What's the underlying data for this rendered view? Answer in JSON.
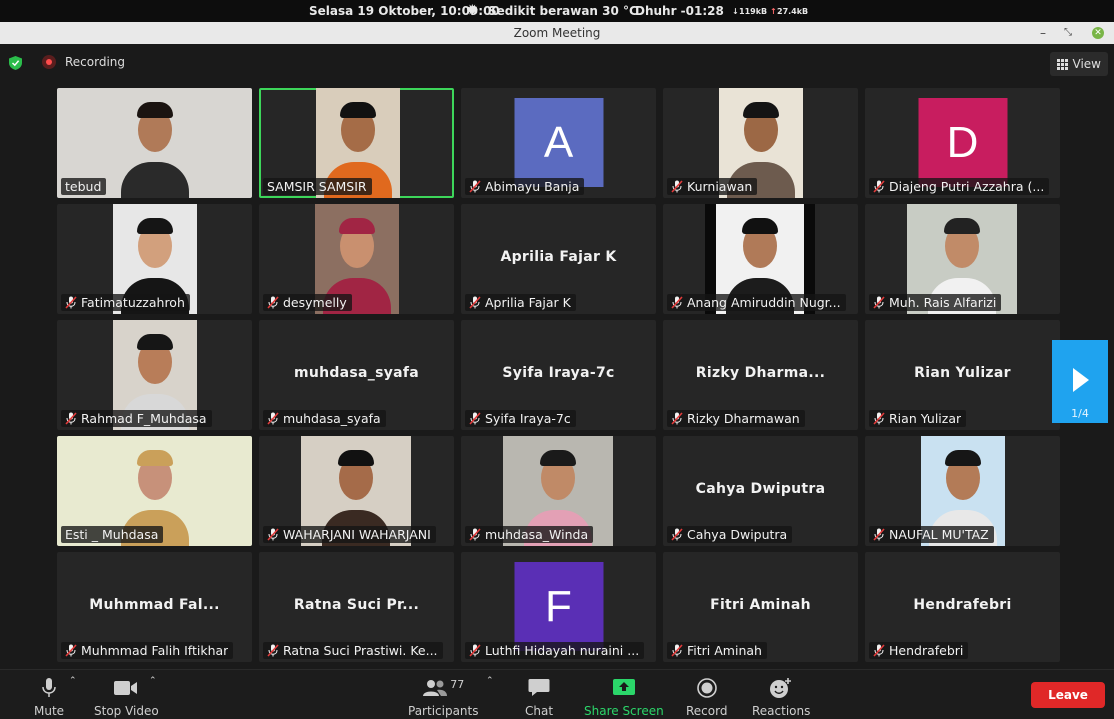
{
  "os_bar": {
    "datetime": "Selasa 19 Oktober, 10:09:00",
    "weather": "Sedikit berawan 30 °C",
    "prayer": "Dhuhr -01:28",
    "net_down": "119kB",
    "net_up": "27.4kB"
  },
  "window": {
    "title": "Zoom Meeting"
  },
  "meeting": {
    "recording_label": "Recording",
    "view_label": "View",
    "page_indicator": "1/4"
  },
  "tiles": [
    {
      "name": "tebud",
      "muted": false,
      "video": true
    },
    {
      "name": "SAMSIR SAMSIR",
      "muted": false,
      "video": true,
      "active": true
    },
    {
      "name": "Abimayu Banja",
      "muted": true,
      "avatar_letter": "A",
      "avatar_color": "#5b6bc0"
    },
    {
      "name": "Kurniawan",
      "muted": true,
      "video": true
    },
    {
      "name": "Diajeng Putri Azzahra (...",
      "muted": true,
      "avatar_letter": "D",
      "avatar_color": "#c81d5f"
    },
    {
      "name": "Fatimatuzzahroh",
      "muted": true,
      "video": true
    },
    {
      "name": "desymelly",
      "muted": true,
      "video": true
    },
    {
      "name": "Aprilia Fajar K",
      "muted": true,
      "display": "Aprilia Fajar K"
    },
    {
      "name": "Anang Amiruddin Nugr...",
      "muted": true,
      "video": true
    },
    {
      "name": "Muh. Rais Alfarizi",
      "muted": true,
      "video": true
    },
    {
      "name": "Rahmad F_Muhdasa",
      "muted": true,
      "video": true
    },
    {
      "name": "muhdasa_syafa",
      "muted": true,
      "display": "muhdasa_syafa"
    },
    {
      "name": "Syifa Iraya-7c",
      "muted": true,
      "display": "Syifa Iraya-7c"
    },
    {
      "name": "Rizky Dharmawan",
      "muted": true,
      "display": "Rizky Dharma..."
    },
    {
      "name": "Rian Yulizar",
      "muted": true,
      "display": "Rian Yulizar"
    },
    {
      "name": "Esti _ Muhdasa",
      "muted": false,
      "video": true
    },
    {
      "name": "WAHARJANI WAHARJANI",
      "muted": true,
      "video": true
    },
    {
      "name": "muhdasa_Winda",
      "muted": true,
      "video": true
    },
    {
      "name": "Cahya Dwiputra",
      "muted": true,
      "display": "Cahya Dwiputra"
    },
    {
      "name": "NAUFAL MU'TAZ",
      "muted": true,
      "video": true
    },
    {
      "name": "Muhmmad Falih Iftikhar",
      "muted": true,
      "display": "Muhmmad Fal..."
    },
    {
      "name": "Ratna Suci Prastiwi. Ke...",
      "muted": true,
      "display": "Ratna Suci Pr..."
    },
    {
      "name": "Luthfi Hidayah nuraini ...",
      "muted": true,
      "avatar_letter": "F",
      "avatar_color": "#5a2fb5"
    },
    {
      "name": "Fitri Aminah",
      "muted": true,
      "display": "Fitri Aminah"
    },
    {
      "name": "Hendrafebri",
      "muted": true,
      "display": "Hendrafebri"
    }
  ],
  "toolbar": {
    "mute": "Mute",
    "stop_video": "Stop Video",
    "participants": "Participants",
    "participants_count": "77",
    "chat": "Chat",
    "share_screen": "Share Screen",
    "record": "Record",
    "reactions": "Reactions",
    "leave": "Leave"
  },
  "colors": {
    "active_speaker": "#3dd65a",
    "share_green": "#2bd66a",
    "leave_red": "#e02828",
    "next_page_blue": "#1fa3ef"
  }
}
